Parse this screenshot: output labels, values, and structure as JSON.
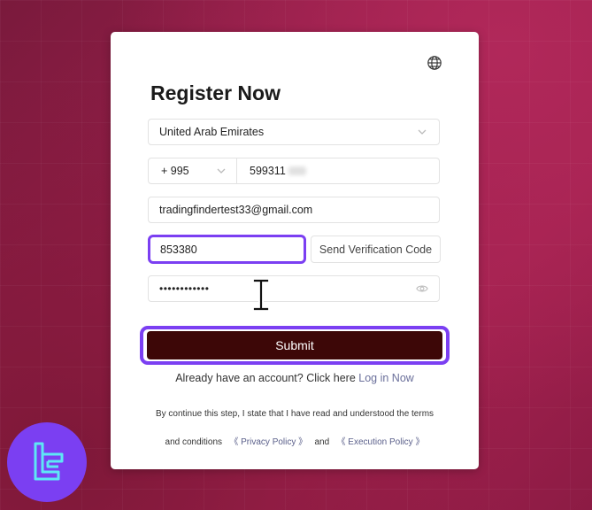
{
  "card": {
    "title": "Register Now",
    "globe_icon": "globe-icon"
  },
  "form": {
    "country_value": "United Arab Emirates",
    "phone_code": "+ 995",
    "phone_number": "599311",
    "email_value": "tradingfindertest33@gmail.com",
    "verification_code": "853380",
    "send_code_label": "Send Verification Code",
    "password_mask": "••••••••••••",
    "submit_label": "Submit"
  },
  "footer": {
    "account_prompt": "Already have an account? Click here",
    "login_link": "Log in Now",
    "terms_line1": "By continue this step, I state that I have read and understood the terms",
    "terms_prefix": "and conditions",
    "privacy_policy": "《 Privacy Policy 》",
    "and_word": "and",
    "execution_policy": "《 Execution Policy 》"
  },
  "colors": {
    "accent": "#7b3ff2",
    "submit_bg": "#3d0707",
    "background": "#9b1f4c"
  }
}
